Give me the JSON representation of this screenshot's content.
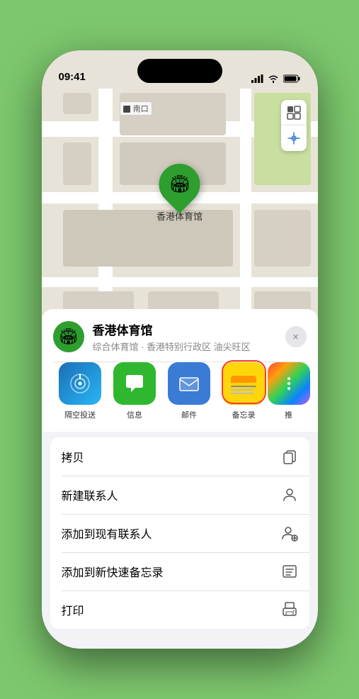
{
  "status_bar": {
    "time": "09:41",
    "location_arrow": "▶"
  },
  "map": {
    "label_text": "南口",
    "pin_label": "香港体育馆"
  },
  "map_controls": {
    "map_btn": "🗺",
    "location_btn": "➤"
  },
  "location_card": {
    "name": "香港体育馆",
    "subtitle": "综合体育馆 · 香港特别行政区 油尖旺区",
    "close_label": "×"
  },
  "share_items": [
    {
      "id": "airdrop",
      "label": "隔空投送",
      "type": "airdrop"
    },
    {
      "id": "messages",
      "label": "信息",
      "type": "messages"
    },
    {
      "id": "mail",
      "label": "邮件",
      "type": "mail"
    },
    {
      "id": "notes",
      "label": "备忘录",
      "type": "notes"
    },
    {
      "id": "more",
      "label": "推",
      "type": "more"
    }
  ],
  "actions": [
    {
      "label": "拷贝",
      "icon": "copy"
    },
    {
      "label": "新建联系人",
      "icon": "person"
    },
    {
      "label": "添加到现有联系人",
      "icon": "person-add"
    },
    {
      "label": "添加到新快速备忘录",
      "icon": "memo"
    },
    {
      "label": "打印",
      "icon": "print"
    }
  ]
}
